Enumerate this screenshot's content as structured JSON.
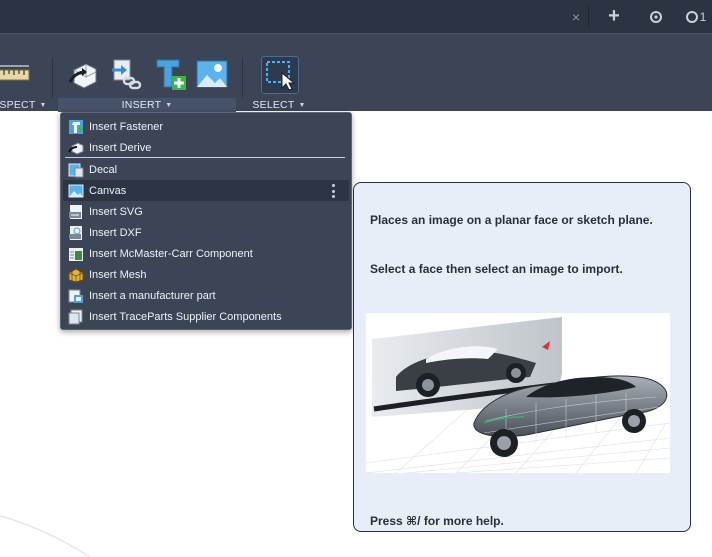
{
  "tabbar": {
    "close_glyph": "×",
    "add_glyph": "+",
    "notification_count": "1",
    "icons": [
      "close-icon",
      "add-tab-icon",
      "sync-icon",
      "notification-icon"
    ]
  },
  "ribbon": {
    "groups": [
      {
        "label": "SPECT",
        "full_label": "INSPECT"
      },
      {
        "label": "INSERT"
      },
      {
        "label": "SELECT"
      }
    ],
    "tools": [
      "measure-icon",
      "insert-derive-icon",
      "insert-link-icon",
      "insert-text-icon",
      "insert-image-icon",
      "select-window-icon"
    ]
  },
  "menu": {
    "items": [
      {
        "label": "Insert Fastener",
        "icon": "fastener-icon"
      },
      {
        "label": "Insert Derive",
        "icon": "derive-icon"
      },
      {
        "label": "Decal",
        "icon": "decal-icon"
      },
      {
        "label": "Canvas",
        "icon": "canvas-icon",
        "highlighted": true
      },
      {
        "label": "Insert SVG",
        "icon": "svg-icon"
      },
      {
        "label": "Insert DXF",
        "icon": "dxf-icon"
      },
      {
        "label": "Insert McMaster-Carr Component",
        "icon": "mcmaster-icon"
      },
      {
        "label": "Insert Mesh",
        "icon": "mesh-icon"
      },
      {
        "label": "Insert a manufacturer part",
        "icon": "manufacturer-part-icon"
      },
      {
        "label": "Insert TraceParts Supplier Components",
        "icon": "traceparts-icon"
      }
    ]
  },
  "tooltip": {
    "description": "Places an image on a planar face or sketch plane.",
    "instruction": "Select a face then select an image to import.",
    "help": "Press ⌘/ for more help."
  },
  "colors": {
    "tabbar_bg": "#2b3442",
    "ribbon_bg": "#3b4556",
    "menu_bg": "#3b4556",
    "menu_highlight": "#2c3544",
    "tooltip_bg": "#e7eef8",
    "accent_blue": "#4aa3df"
  }
}
